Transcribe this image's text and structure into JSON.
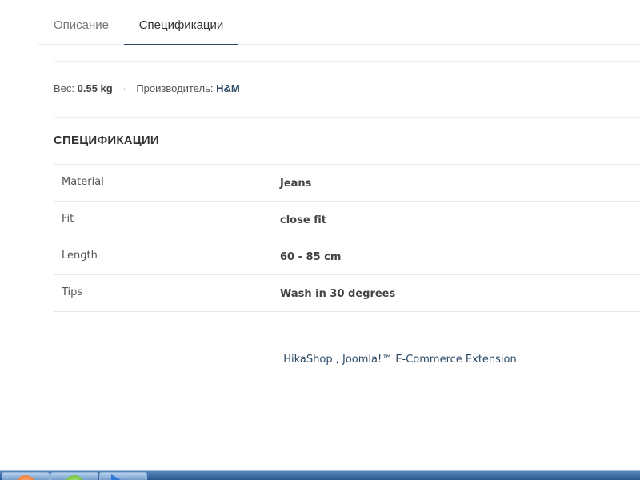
{
  "tabs": [
    {
      "label": "Описание",
      "active": false
    },
    {
      "label": "Спецификации",
      "active": true
    }
  ],
  "meta": {
    "weight_label": "Вес:",
    "weight_value": "0.55 kg",
    "separator": "·",
    "manufacturer_label": "Производитель:",
    "manufacturer_value": "H&M"
  },
  "specs": {
    "title": "СПЕЦИФИКАЦИИ",
    "rows": [
      {
        "name": "Material",
        "value": "Jeans"
      },
      {
        "name": "Fit",
        "value": "close fit"
      },
      {
        "name": "Length",
        "value": "60 - 85 cm"
      },
      {
        "name": "Tips",
        "value": "Wash in 30 degrees"
      }
    ]
  },
  "footer": {
    "text": "HikaShop , Joomla!™ E-Commerce Extension"
  },
  "taskbar": {
    "buttons": [
      {
        "icon": "firefox-icon"
      },
      {
        "icon": "chrome-icon"
      },
      {
        "icon": "media-player-icon"
      }
    ]
  },
  "colors": {
    "accent": "#2c4a66",
    "taskbar": "#2b5a92"
  }
}
